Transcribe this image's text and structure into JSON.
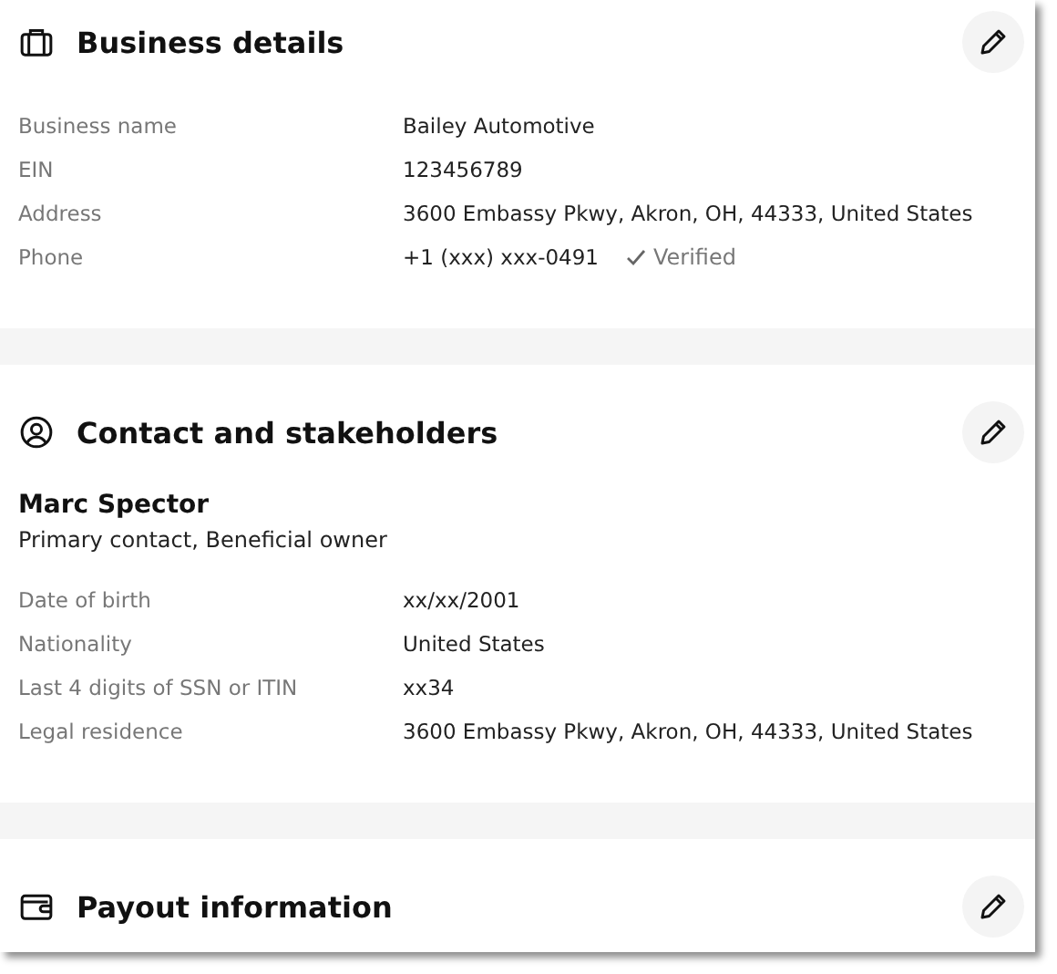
{
  "sections": [
    {
      "title": "Business details",
      "rows": [
        {
          "label": "Business name",
          "value": "Bailey Automotive"
        },
        {
          "label": "EIN",
          "value": "123456789"
        },
        {
          "label": "Address",
          "value": "3600 Embassy Pkwy, Akron, OH, 44333, United States"
        },
        {
          "label": "Phone",
          "value": "+1 (xxx) xxx-0491",
          "badge": "Verified"
        }
      ]
    },
    {
      "title": "Contact and stakeholders",
      "contact": {
        "name": "Marc Spector",
        "roles": "Primary contact, Beneficial owner"
      },
      "rows": [
        {
          "label": "Date of birth",
          "value": "xx/xx/2001"
        },
        {
          "label": "Nationality",
          "value": "United States"
        },
        {
          "label": "Last 4 digits of SSN or ITIN",
          "value": "xx34"
        },
        {
          "label": "Legal residence",
          "value": "3600 Embassy Pkwy, Akron, OH, 44333, United States"
        }
      ]
    },
    {
      "title": "Payout information"
    }
  ]
}
